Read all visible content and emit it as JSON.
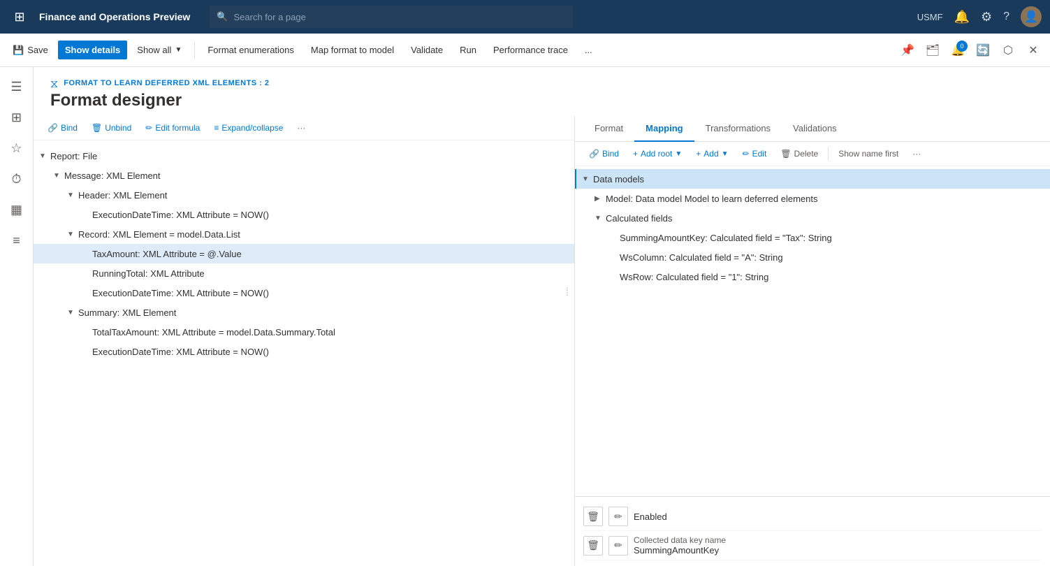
{
  "topnav": {
    "grid_icon": "⋮⋮⋮",
    "title": "Finance and Operations Preview",
    "search_placeholder": "Search for a page",
    "user": "USMF",
    "notification_icon": "🔔",
    "settings_icon": "⚙",
    "help_icon": "?",
    "avatar_label": "User Avatar"
  },
  "toolbar": {
    "save_label": "Save",
    "show_details_label": "Show details",
    "show_all_label": "Show all",
    "format_enumerations_label": "Format enumerations",
    "map_format_label": "Map format to model",
    "validate_label": "Validate",
    "run_label": "Run",
    "performance_trace_label": "Performance trace",
    "more_label": "...",
    "pin_icon": "📌",
    "notifications_badge": "0"
  },
  "breadcrumb": "FORMAT TO LEARN DEFERRED XML ELEMENTS : 2",
  "page_title": "Format designer",
  "left_panel": {
    "bind_label": "Bind",
    "unbind_label": "Unbind",
    "edit_formula_label": "Edit formula",
    "expand_collapse_label": "Expand/collapse",
    "more_label": "···",
    "tree_items": [
      {
        "id": "report",
        "label": "Report: File",
        "indent": 0,
        "chevron": "▼",
        "selected": false
      },
      {
        "id": "message",
        "label": "Message: XML Element",
        "indent": 1,
        "chevron": "▼",
        "selected": false
      },
      {
        "id": "header",
        "label": "Header: XML Element",
        "indent": 2,
        "chevron": "▼",
        "selected": false
      },
      {
        "id": "exec-dt-1",
        "label": "ExecutionDateTime: XML Attribute = NOW()",
        "indent": 3,
        "chevron": "",
        "selected": false
      },
      {
        "id": "record",
        "label": "Record: XML Element = model.Data.List",
        "indent": 2,
        "chevron": "▼",
        "selected": false
      },
      {
        "id": "taxamount",
        "label": "TaxAmount: XML Attribute = @.Value",
        "indent": 3,
        "chevron": "",
        "selected": true
      },
      {
        "id": "runningtotal",
        "label": "RunningTotal: XML Attribute",
        "indent": 3,
        "chevron": "",
        "selected": false
      },
      {
        "id": "exec-dt-2",
        "label": "ExecutionDateTime: XML Attribute = NOW()",
        "indent": 3,
        "chevron": "",
        "selected": false,
        "drag": true
      },
      {
        "id": "summary",
        "label": "Summary: XML Element",
        "indent": 2,
        "chevron": "▼",
        "selected": false
      },
      {
        "id": "totaltax",
        "label": "TotalTaxAmount: XML Attribute = model.Data.Summary.Total",
        "indent": 3,
        "chevron": "",
        "selected": false
      },
      {
        "id": "exec-dt-3",
        "label": "ExecutionDateTime: XML Attribute = NOW()",
        "indent": 3,
        "chevron": "",
        "selected": false
      }
    ]
  },
  "right_panel": {
    "tabs": [
      {
        "id": "format",
        "label": "Format",
        "active": false
      },
      {
        "id": "mapping",
        "label": "Mapping",
        "active": true
      },
      {
        "id": "transformations",
        "label": "Transformations",
        "active": false
      },
      {
        "id": "validations",
        "label": "Validations",
        "active": false
      }
    ],
    "bind_label": "Bind",
    "add_root_label": "Add root",
    "add_label": "Add",
    "edit_label": "Edit",
    "delete_label": "Delete",
    "show_name_first_label": "Show name first",
    "more_label": "···",
    "model_tree": [
      {
        "id": "data-models",
        "label": "Data models",
        "indent": 0,
        "chevron": "▼",
        "selected": true
      },
      {
        "id": "model",
        "label": "Model: Data model Model to learn deferred elements",
        "indent": 1,
        "chevron": "▶",
        "selected": false
      },
      {
        "id": "calc-fields",
        "label": "Calculated fields",
        "indent": 1,
        "chevron": "▼",
        "selected": false
      },
      {
        "id": "summing",
        "label": "SummingAmountKey: Calculated field = \"Tax\": String",
        "indent": 2,
        "chevron": "",
        "selected": false
      },
      {
        "id": "wscol",
        "label": "WsColumn: Calculated field = \"A\": String",
        "indent": 2,
        "chevron": "",
        "selected": false
      },
      {
        "id": "wsrow",
        "label": "WsRow: Calculated field = \"1\": String",
        "indent": 2,
        "chevron": "",
        "selected": false
      }
    ],
    "prop_enabled_label": "Enabled",
    "prop_delete_icon": "🗑",
    "prop_edit_icon": "✏",
    "prop_field_label": "Collected data key name",
    "prop_field_value": "SummingAmountKey",
    "prop_field_delete_icon": "🗑",
    "prop_field_edit_icon": "✏"
  },
  "left_sidebar_icons": [
    "≡",
    "⊞",
    "★",
    "⏱",
    "▦",
    "≡"
  ]
}
